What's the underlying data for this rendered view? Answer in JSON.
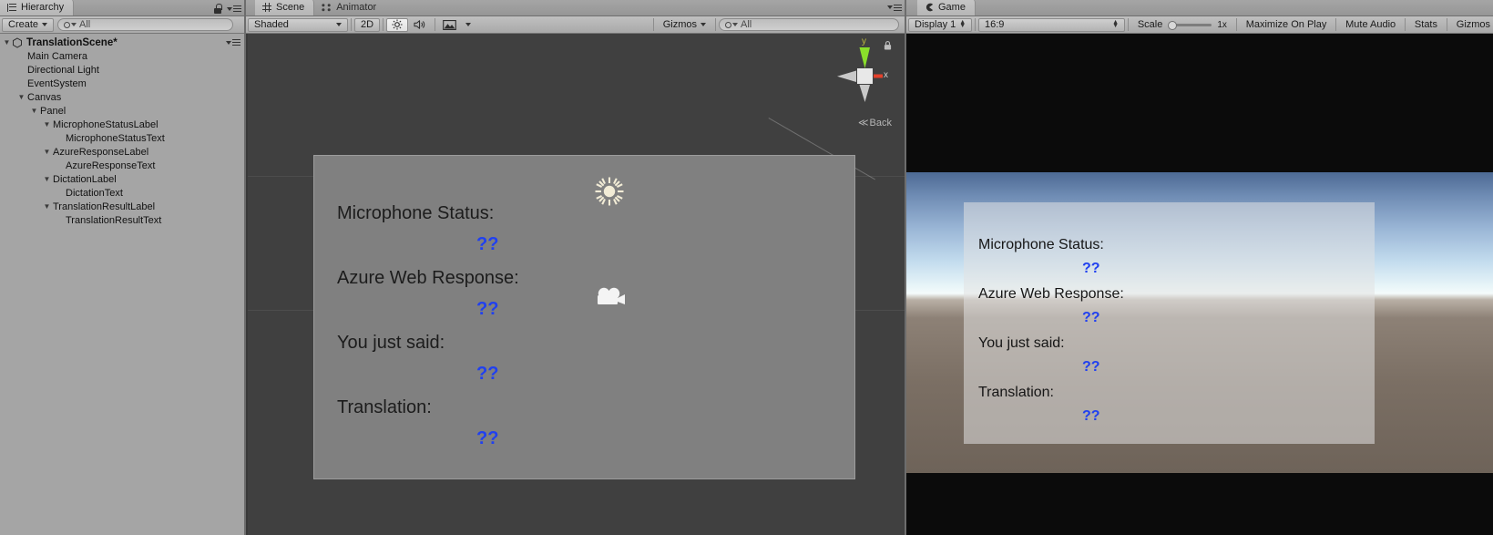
{
  "hierarchy": {
    "tab_label": "Hierarchy",
    "tab_icon": "hierarchy-icon",
    "lock_icon": "lock-icon",
    "menu_icon": "hamburger-menu-icon",
    "create_label": "Create",
    "search_placeholder": "All",
    "search_value": "",
    "scene_name": "TranslationScene*",
    "items": [
      {
        "label": "Main Camera",
        "depth": 1,
        "expandable": false
      },
      {
        "label": "Directional Light",
        "depth": 1,
        "expandable": false
      },
      {
        "label": "EventSystem",
        "depth": 1,
        "expandable": false
      },
      {
        "label": "Canvas",
        "depth": 1,
        "expandable": true
      },
      {
        "label": "Panel",
        "depth": 2,
        "expandable": true
      },
      {
        "label": "MicrophoneStatusLabel",
        "depth": 3,
        "expandable": true
      },
      {
        "label": "MicrophoneStatusText",
        "depth": 4,
        "expandable": false
      },
      {
        "label": "AzureResponseLabel",
        "depth": 3,
        "expandable": true
      },
      {
        "label": "AzureResponseText",
        "depth": 4,
        "expandable": false
      },
      {
        "label": "DictationLabel",
        "depth": 3,
        "expandable": true
      },
      {
        "label": "DictationText",
        "depth": 4,
        "expandable": false
      },
      {
        "label": "TranslationResultLabel",
        "depth": 3,
        "expandable": true
      },
      {
        "label": "TranslationResultText",
        "depth": 4,
        "expandable": false
      }
    ]
  },
  "scene": {
    "tab_label": "Scene",
    "tab_icon": "scene-grid-icon",
    "animator_tab_label": "Animator",
    "animator_tab_icon": "animator-icon",
    "menu_icon": "hamburger-menu-icon",
    "shading_mode": "Shaded",
    "mode_2d": "2D",
    "lighting_icon": "sun-lighting-icon",
    "audio_icon": "speaker-audio-icon",
    "fx_icon": "image-effects-icon",
    "gizmos_label": "Gizmos",
    "search_placeholder": "All",
    "gizmo": {
      "y_axis_label": "y",
      "x_axis_label": "x",
      "view_label": "Back",
      "lock_icon": "persp-lock-icon",
      "y_axis_color": "#8ade2b",
      "x_axis_color": "#e5412b",
      "z_axis_color": "#d0d0d0"
    },
    "canvas_panel": {
      "rows": [
        {
          "label": "Microphone Status:",
          "value": "??"
        },
        {
          "label": "Azure Web Response:",
          "value": "??"
        },
        {
          "label": "You just said:",
          "value": "??"
        },
        {
          "label": "Translation:",
          "value": "??"
        }
      ],
      "light_gizmo_icon": "directional-light-sun-icon",
      "camera_gizmo_icon": "main-camera-icon",
      "background_color": "#808080",
      "value_color": "#2040f0"
    }
  },
  "game": {
    "tab_label": "Game",
    "tab_icon": "game-pacman-icon",
    "menu_icon": "hamburger-menu-icon",
    "display_label": "Display 1",
    "aspect_label": "16:9",
    "scale_label": "Scale",
    "scale_value": "1x",
    "maximize_label": "Maximize On Play",
    "mute_label": "Mute Audio",
    "stats_label": "Stats",
    "gizmos_label": "Gizmos",
    "panel": {
      "rows": [
        {
          "label": "Microphone Status:",
          "value": "??"
        },
        {
          "label": "Azure Web Response:",
          "value": "??"
        },
        {
          "label": "You just said:",
          "value": "??"
        },
        {
          "label": "Translation:",
          "value": "??"
        }
      ],
      "value_color": "#2040f0"
    }
  }
}
